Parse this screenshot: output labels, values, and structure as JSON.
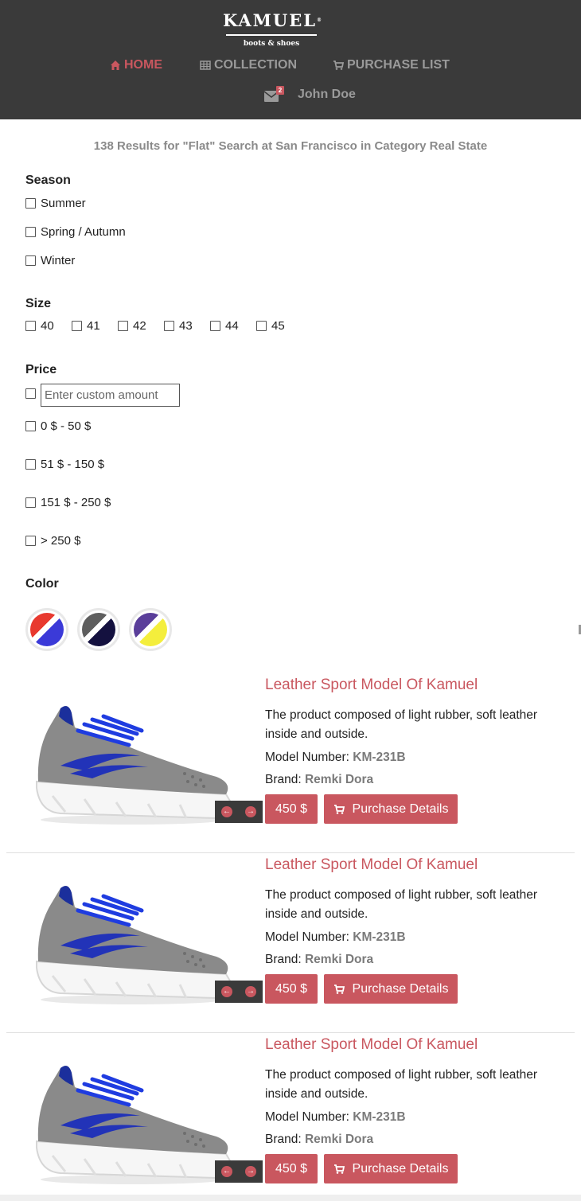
{
  "brand": {
    "name": "KAMUEL",
    "registered": "®",
    "tagline": "boots & shoes"
  },
  "nav": {
    "home": "HOME",
    "collection": "COLLECTION",
    "purchase_list": "PURCHASE LIST",
    "messages_count": "2",
    "user_name": "John Doe"
  },
  "results": {
    "title": "138 Results for \"Flat\" Search at San Francisco in Category Real State"
  },
  "filters": {
    "season": {
      "label": "Season",
      "options": [
        "Summer",
        "Spring / Autumn",
        "Winter"
      ]
    },
    "size": {
      "label": "Size",
      "options": [
        "40",
        "41",
        "42",
        "43",
        "44",
        "45"
      ]
    },
    "price": {
      "label": "Price",
      "custom_placeholder": "Enter custom amount",
      "options": [
        "0 $ - 50 $",
        "51 $ - 150 $",
        "151 $ - 250 $",
        "> 250 $"
      ]
    },
    "color": {
      "label": "Color",
      "swatches": [
        {
          "a": "#e8392f",
          "b": "#3b3ad8"
        },
        {
          "a": "#5e5e5e",
          "b": "#14113f"
        },
        {
          "a": "#5a3e9a",
          "b": "#f4ee3c"
        }
      ]
    }
  },
  "products": [
    {
      "title": "Leather Sport Model Of Kamuel",
      "description": "The product composed of light rubber, soft leather inside and outside.",
      "model_label": "Model Number:",
      "model": "KM-231B",
      "brand_label": "Brand:",
      "brand": "Remki Dora",
      "price": "450 $",
      "details_label": "Purchase Details"
    },
    {
      "title": "Leather Sport Model Of Kamuel",
      "description": "The product composed of light rubber, soft leather inside and outside.",
      "model_label": "Model Number:",
      "model": "KM-231B",
      "brand_label": "Brand:",
      "brand": "Remki Dora",
      "price": "450 $",
      "details_label": "Purchase Details"
    },
    {
      "title": "Leather Sport Model Of Kamuel",
      "description": "The product composed of light rubber, soft leather inside and outside.",
      "model_label": "Model Number:",
      "model": "KM-231B",
      "brand_label": "Brand:",
      "brand": "Remki Dora",
      "price": "450 $",
      "details_label": "Purchase Details"
    }
  ],
  "colors": {
    "header_bg": "#3a3a3a",
    "accent": "#c9575f",
    "muted": "#9a9a9a"
  },
  "icons": {
    "home": "home-icon",
    "collection": "grid-icon",
    "purchase_list": "cart-icon",
    "messages": "envelope-icon",
    "prev": "arrow-left-icon",
    "next": "arrow-right-icon"
  }
}
